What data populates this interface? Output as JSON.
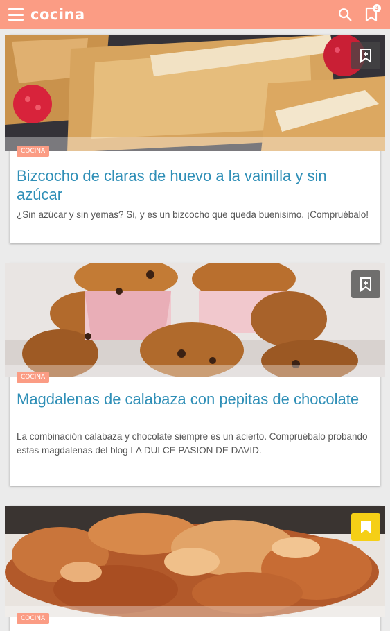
{
  "appbar": {
    "title": "cocina",
    "saved_count": "3",
    "icons": {
      "menu": "menu-icon",
      "search": "search-icon",
      "bookmarks": "bookmark-icon"
    }
  },
  "colors": {
    "primary": "#fb9c84",
    "title_blue": "#2f8fb7",
    "saved_yellow": "#f5cf16"
  },
  "cards": [
    {
      "tag": "COCINA",
      "title": "Bizcocho de claras de huevo a la vainilla y sin azúcar",
      "description": "¿Sin azúcar y sin yemas? Si, y es un bizcocho que queda buenisimo. ¡Compruébalo!",
      "image": "sponge-cake-with-raspberries",
      "saved": false
    },
    {
      "tag": "COCINA",
      "title": "Magdalenas de calabaza con pepitas de chocolate",
      "description": "La combinación calabaza y chocolate siempre es un acierto. Compruébalo probando estas magdalenas del blog LA DULCE PASION DE DAVID.",
      "image": "pumpkin-chocolate-chip-muffins",
      "saved": false
    },
    {
      "tag": "COCINA",
      "title": "",
      "description": "",
      "image": "glazed-chicken-pieces",
      "saved": true
    }
  ]
}
